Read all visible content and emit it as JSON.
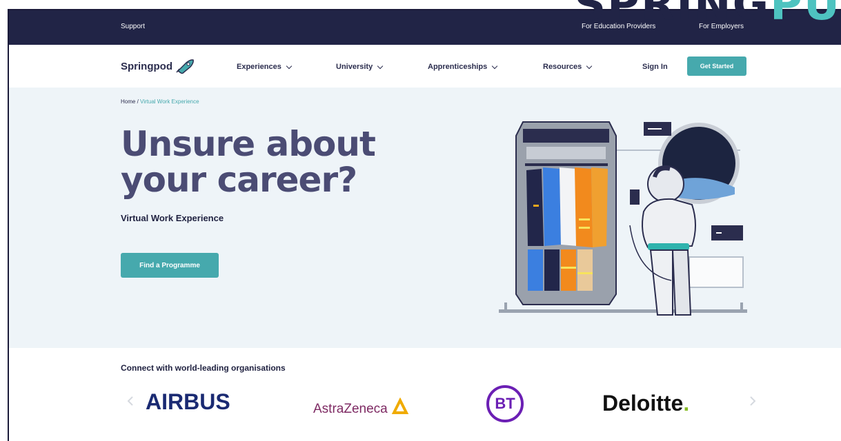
{
  "banner": {
    "text_main": "SPRING",
    "text_accent": "PU"
  },
  "topbar": {
    "support": "Support",
    "education": "For Education Providers",
    "employers": "For Employers"
  },
  "nav": {
    "logo": "Springpod",
    "items": [
      {
        "label": "Experiences"
      },
      {
        "label": "University"
      },
      {
        "label": "Apprenticeships"
      },
      {
        "label": "Resources"
      }
    ],
    "sign_in": "Sign In",
    "get_started": "Get Started"
  },
  "hero": {
    "breadcrumb_home": "Home",
    "breadcrumb_sep": "/",
    "breadcrumb_current": "Virtual Work Experience",
    "headline_line1": "Unsure about",
    "headline_line2": "your career?",
    "subtitle": "Virtual Work Experience",
    "cta": "Find a Programme"
  },
  "orgs": {
    "title": "Connect with world-leading organisations",
    "logos": [
      {
        "name": "AIRBUS"
      },
      {
        "name": "AstraZeneca"
      },
      {
        "name": "BT"
      },
      {
        "name": "Deloitte",
        "suffix": "."
      }
    ]
  },
  "colors": {
    "navy": "#212446",
    "teal": "#46a9ad",
    "headline": "#4b4c74",
    "hero_bg": "#eef4f8"
  }
}
